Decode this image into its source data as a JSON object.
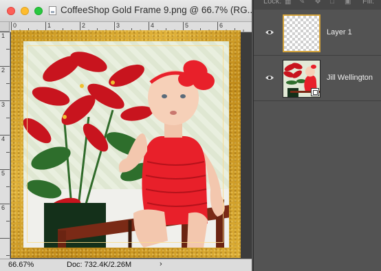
{
  "window": {
    "title": "CoffeeShop Gold Frame 9.png @ 66.7% (RG..."
  },
  "rulers": {
    "horizontal": [
      "0",
      "1",
      "2",
      "3",
      "4",
      "5",
      "6"
    ],
    "vertical": [
      "1",
      "2",
      "3",
      "4",
      "5",
      "6"
    ]
  },
  "status": {
    "zoom": "66.67%",
    "doc": "Doc: 732.4K/2.26M",
    "arrow": "›"
  },
  "layers_panel": {
    "lock_label": "Lock:",
    "fill_label": "Fill:",
    "lock_icons": [
      "lock-transparent-icon",
      "lock-paint-icon",
      "lock-move-icon",
      "lock-artboard-icon",
      "lock-all-icon"
    ],
    "layers": [
      {
        "name": "Layer 1",
        "visible": true,
        "thumbnail": "transparent"
      },
      {
        "name": "Jill Wellington",
        "visible": true,
        "thumbnail": "photo",
        "smart_object": true
      }
    ]
  },
  "colors": {
    "frame_gold": "#d4a22c",
    "poinsettia_red": "#c8141e",
    "dress_red": "#e8202a",
    "panel_bg": "#535353"
  }
}
